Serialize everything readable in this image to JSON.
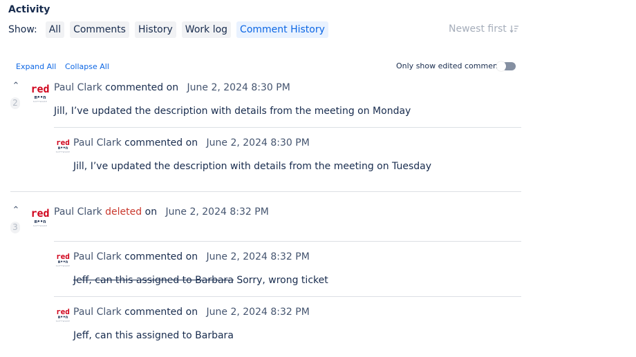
{
  "activity": {
    "title": "Activity",
    "show_label": "Show:",
    "tabs": [
      {
        "label": "All"
      },
      {
        "label": "Comments"
      },
      {
        "label": "History"
      },
      {
        "label": "Work log"
      },
      {
        "label": "Comment History"
      }
    ],
    "active_tab": "Comment History",
    "sort_label": "Newest first",
    "sort_icon": "sort-descending-icon"
  },
  "controls": {
    "expand_all": "Expand All",
    "collapse_all": "Collapse All",
    "only_edited_label": "Only show edited comments",
    "only_edited_on": false
  },
  "logo": {
    "line1": "red",
    "line2": "m••n",
    "line3": "SOFTWARE"
  },
  "threads": [
    {
      "count": "2",
      "author": "Paul Clark",
      "verb": "commented on",
      "date": "June 2, 2024 8:30 PM",
      "text": "Jill, I’ve updated the description with details from the meeting on Monday",
      "history": [
        {
          "author": "Paul Clark",
          "verb": "commented on",
          "date": "June 2, 2024 8:30 PM",
          "text": "Jill, I’ve updated the description with details from the meeting on Tuesday"
        }
      ]
    },
    {
      "count": "3",
      "author": "Paul Clark",
      "verb": "deleted",
      "verb_suffix": "on",
      "date": "June 2, 2024 8:32 PM",
      "history": [
        {
          "author": "Paul Clark",
          "verb": "commented on",
          "date": "June 2, 2024 8:32 PM",
          "struck": "Jeff, can this assigned to Barbara",
          "text": "Sorry, wrong ticket"
        },
        {
          "author": "Paul Clark",
          "verb": "commented on",
          "date": "June 2, 2024 8:32 PM",
          "text": "Jeff, can this assigned to Barbara"
        }
      ]
    }
  ],
  "colors": {
    "accent": "#0c66e4",
    "deleted": "#c9372c",
    "logo_red": "#d0021b"
  }
}
